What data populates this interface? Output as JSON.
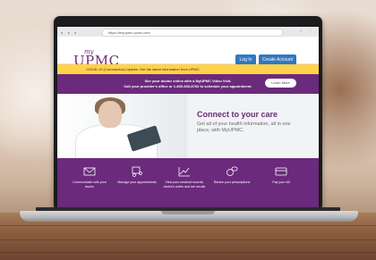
{
  "browser": {
    "url": "https://myupmc.upmc.com"
  },
  "header": {
    "logo_my": "my",
    "logo_name": "UPMC",
    "login_label": "Log In",
    "create_account_label": "Create Account"
  },
  "alert": {
    "text": "COVID-19 (Coronavirus) Update: Get the latest information from UPMC."
  },
  "video_banner": {
    "line1": "See your doctor online with a MyUPMC Video Visit.",
    "line2": "Call your provider's office or 1-800-533-8762 to schedule your appointment.",
    "learn_more_label": "Learn More"
  },
  "hero": {
    "title": "Connect to your care",
    "subtitle": "Get all of your health information, all in one place, with MyUPMC."
  },
  "features": [
    {
      "icon": "envelope-icon",
      "label": "Communicate with your doctor"
    },
    {
      "icon": "calendar-people-icon",
      "label": "Manage your appointments"
    },
    {
      "icon": "chart-icon",
      "label": "View your medical records, doctor's notes and lab results"
    },
    {
      "icon": "pills-icon",
      "label": "Renew your prescriptions"
    },
    {
      "icon": "credit-card-icon",
      "label": "Pay your bill"
    }
  ],
  "colors": {
    "brand_purple": "#6b2a7c",
    "alert_yellow": "#ffd24a",
    "button_blue": "#2f78c3"
  }
}
